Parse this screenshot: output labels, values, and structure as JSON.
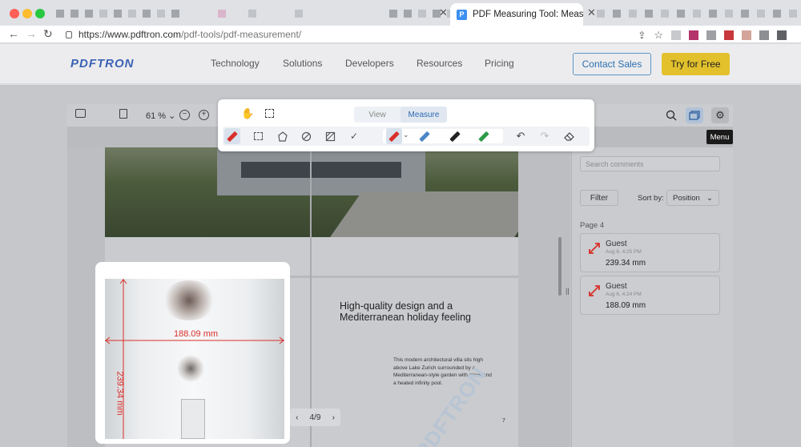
{
  "browser": {
    "active_tab_title": "PDF Measuring Tool: Measure",
    "favicon_letter": "P",
    "url_domain": "https://www.pdftron.com",
    "url_path": "/pdf-tools/pdf-measurement/",
    "tab_close_glyph": "✕"
  },
  "site": {
    "logo": "PDFTRON",
    "nav": [
      "Technology",
      "Solutions",
      "Developers",
      "Resources",
      "Pricing"
    ],
    "contact_label": "Contact Sales",
    "try_label": "Try for Free"
  },
  "viewer": {
    "zoom": "61 %",
    "zoom_caret": "⌄",
    "menu_tooltip": "Menu",
    "mode_tabs": [
      "View",
      "Measure"
    ],
    "active_mode": "Measure",
    "pager": "4/9",
    "accent_color": "#2e6bb3",
    "measure_color": "#d92f2a"
  },
  "document": {
    "headline": "High-quality design and a Mediterranean holiday feeling",
    "body": "This modern architectural villa sits high above Lake Zurich surrounded by a Mediterranean-style garden with pines and a heated infinity pool.",
    "page_number": "7",
    "watermark": "PDFTRON",
    "measure_horizontal": "188.09 mm",
    "measure_vertical": "239.34 mm"
  },
  "comments": {
    "search_placeholder": "Search comments",
    "filter_label": "Filter",
    "sort_label": "Sort by:",
    "sort_value": "Position",
    "page_label": "Page 4",
    "items": [
      {
        "author": "Guest",
        "date": "Aug 6, 4:25 PM",
        "value": "239.34 mm"
      },
      {
        "author": "Guest",
        "date": "Aug 6, 4:24 PM",
        "value": "188.09 mm"
      }
    ]
  }
}
